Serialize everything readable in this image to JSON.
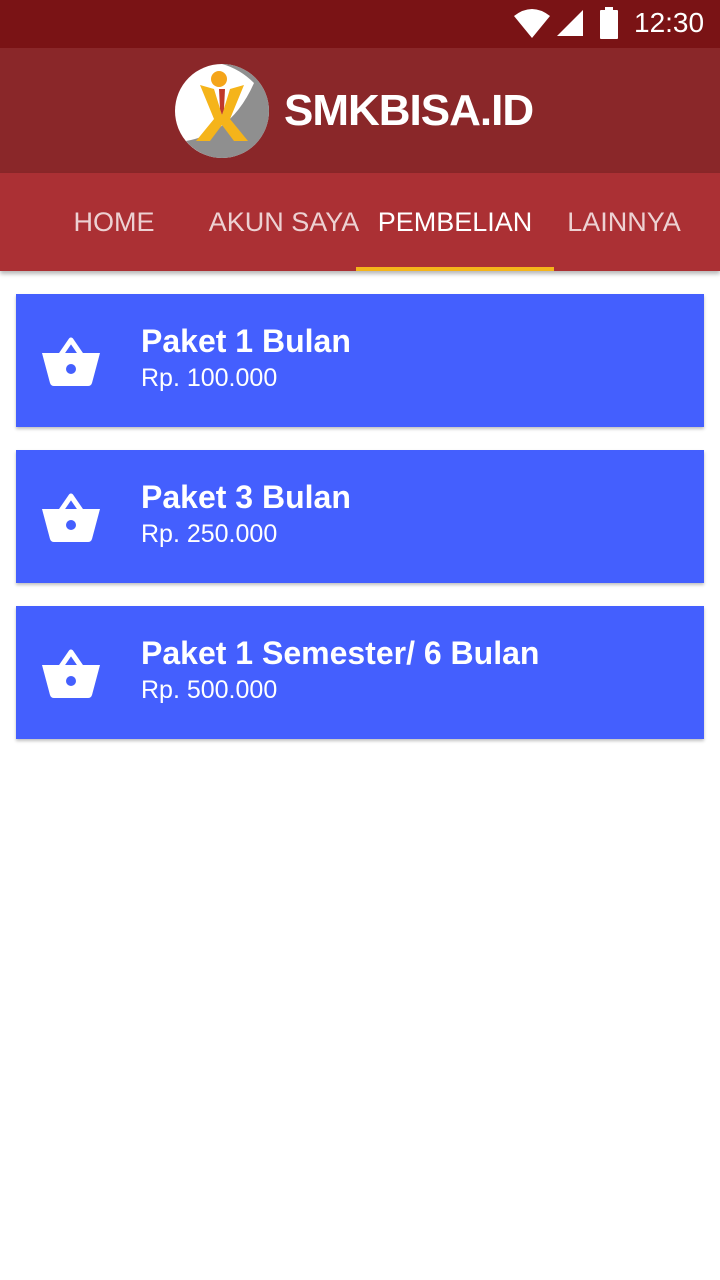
{
  "status_bar": {
    "time": "12:30",
    "icons": [
      "wifi-icon",
      "signal-icon",
      "battery-icon"
    ]
  },
  "header": {
    "brand": "SMKBISA.ID",
    "logo_icon": "smkbisa-logo-icon"
  },
  "tabs": [
    {
      "label": "HOME",
      "active": false
    },
    {
      "label": "AKUN SAYA",
      "active": false
    },
    {
      "label": "PEMBELIAN",
      "active": true
    },
    {
      "label": "LAINNYA",
      "active": false
    }
  ],
  "packages": [
    {
      "title": "Paket 1 Bulan",
      "price": "Rp. 100.000",
      "icon": "basket-icon"
    },
    {
      "title": "Paket 3 Bulan",
      "price": "Rp. 250.000",
      "icon": "basket-icon"
    },
    {
      "title": "Paket 1 Semester/ 6 Bulan",
      "price": "Rp. 500.000",
      "icon": "basket-icon"
    }
  ],
  "colors": {
    "status_bar": "#7a1315",
    "header": "#8a2729",
    "tab_bar": "#ab3034",
    "tab_indicator": "#f5b41a",
    "card": "#445ffe"
  }
}
